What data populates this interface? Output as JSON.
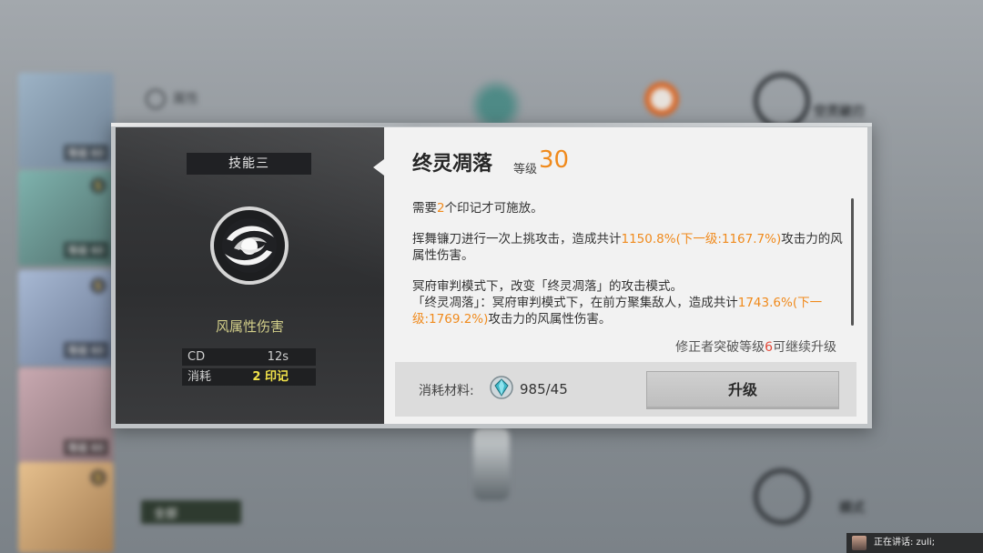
{
  "background": {
    "attribute_label": "属性",
    "all_button": "全部",
    "right_labels": [
      "空灵破刃",
      "模式"
    ],
    "characters": [
      {
        "level": "等级 60",
        "locked": false
      },
      {
        "level": "等级 60",
        "locked": true
      },
      {
        "level": "等级 60",
        "locked": true
      },
      {
        "level": "等级 60",
        "locked": false
      },
      {
        "level": "等级 60",
        "locked": true
      }
    ]
  },
  "skill": {
    "slot_label": "技能三",
    "element_label": "风属性伤害",
    "stats": {
      "cd_key": "CD",
      "cd_value": "12s",
      "cost_key": "消耗",
      "cost_value": "2 印记"
    },
    "name": "终灵凋落",
    "level_label": "等级",
    "level_value": "30",
    "description": {
      "p1_a": "需要",
      "p1_num": "2",
      "p1_b": "个印记才可施放。",
      "p2_a": "挥舞镰刀进行一次上挑攻击，造成共计",
      "p2_hl": "1150.8%(下一级:1167.7%)",
      "p2_b": "攻击力的风属性伤害。",
      "p3": "冥府审判模式下，改变「终灵凋落」的攻击模式。",
      "p4_a": "「终灵凋落」：冥府审判模式下，在前方聚集敌人，造成共计",
      "p4_hl": "1743.6%(下一级:1769.2%)",
      "p4_b": "攻击力的风属性伤害。"
    },
    "requirement": {
      "prefix": "修正者突破等级",
      "num": "6",
      "suffix": "可继续升级"
    }
  },
  "upgrade": {
    "material_label": "消耗材料:",
    "material_icon": "crystal-icon",
    "material_count": "985/45",
    "button_label": "升级"
  },
  "speaking": {
    "text": "正在讲话: zuli;"
  },
  "colors": {
    "highlight": "#f08a1c",
    "requirement_number": "#e34a3a",
    "cost_value": "#f2e34a",
    "element_label": "#d3cf8a"
  }
}
